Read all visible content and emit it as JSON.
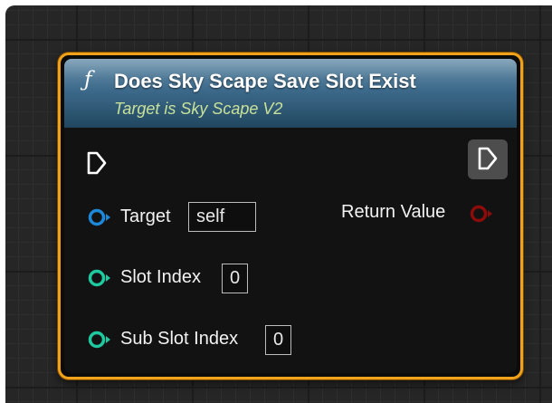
{
  "node": {
    "title": "Does Sky Scape Save Slot Exist",
    "subtitle": "Target is Sky Scape V2",
    "icon": "function-icon",
    "colors": {
      "border": "#f0a21b",
      "header": "#3d6a8b",
      "target_pin": "#1e88d8",
      "int_pin": "#1fc9a0",
      "bool_pin": "#8c0b0b"
    }
  },
  "pins": {
    "target": {
      "label": "Target",
      "value": "self"
    },
    "slot_index": {
      "label": "Slot Index",
      "value": "0"
    },
    "sub_slot_index": {
      "label": "Sub Slot Index",
      "value": "0"
    },
    "return_value": {
      "label": "Return Value"
    }
  }
}
